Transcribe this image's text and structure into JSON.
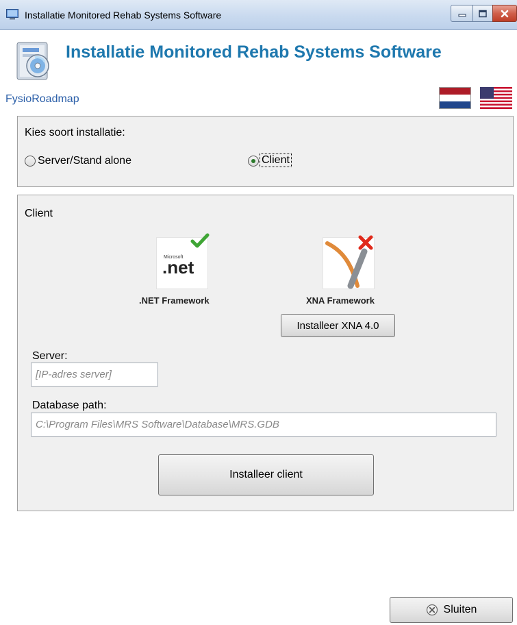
{
  "window": {
    "title": "Installatie Monitored Rehab Systems Software"
  },
  "header": {
    "title": "Installatie Monitored Rehab Systems Software",
    "product": "FysioRoadmap",
    "flags": [
      "flag-nl-icon",
      "flag-us-icon"
    ]
  },
  "install_type": {
    "heading": "Kies soort installatie:",
    "options": [
      {
        "label": "Server/Stand alone",
        "selected": false
      },
      {
        "label": "Client",
        "selected": true
      }
    ]
  },
  "client": {
    "heading": "Client",
    "frameworks": [
      {
        "label": ".NET Framework",
        "icon": "dotnet-icon",
        "status": "installed"
      },
      {
        "label": "XNA Framework",
        "icon": "xna-icon",
        "status": "missing"
      }
    ],
    "install_xna_label": "Installeer XNA 4.0",
    "server_label": "Server:",
    "server_placeholder": "[IP-adres server]",
    "server_value": "",
    "db_label": "Database path:",
    "db_placeholder": "C:\\Program Files\\MRS Software\\Database\\MRS.GDB",
    "db_value": "",
    "install_client_label": "Installeer client"
  },
  "footer": {
    "close_label": "Sluiten"
  },
  "colors": {
    "title_blue": "#1e78ae",
    "link_blue": "#2a5ea8",
    "check_green": "#3fa535",
    "cross_red": "#e02a1b"
  }
}
